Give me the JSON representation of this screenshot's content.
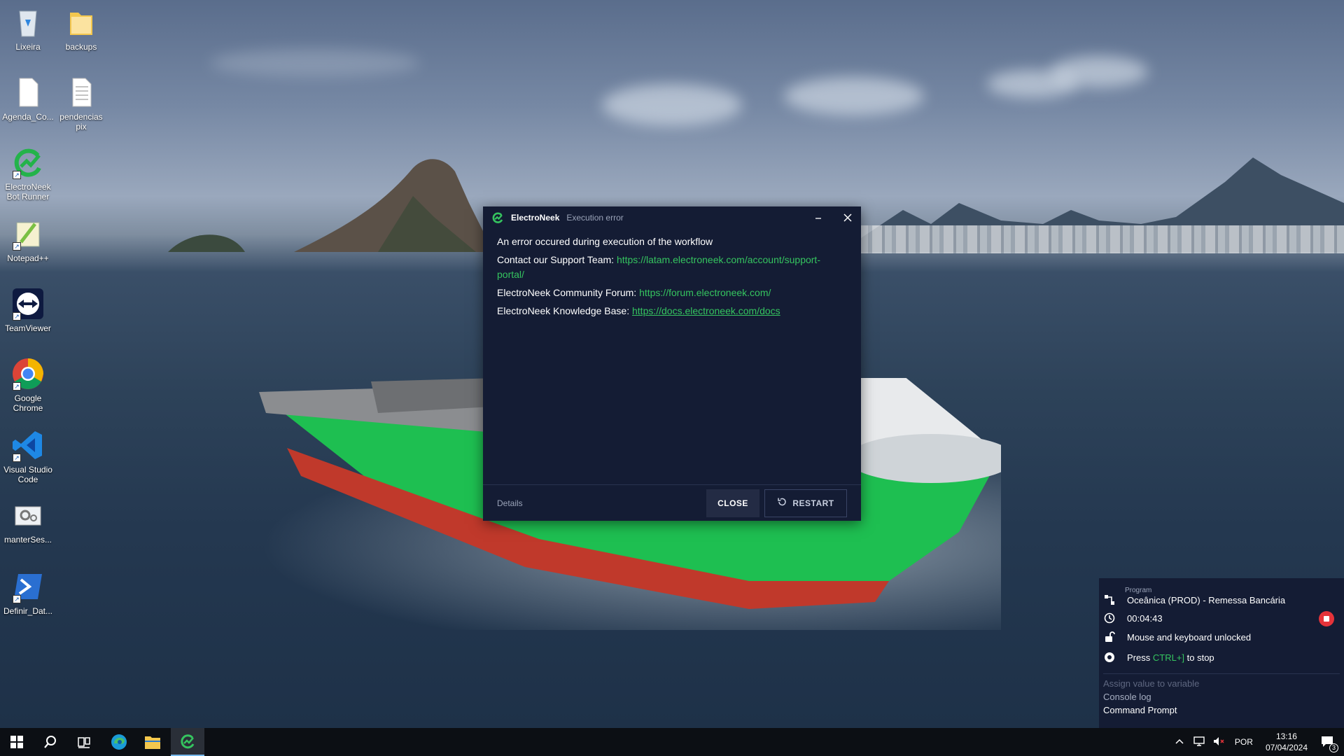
{
  "desktop": {
    "icons": [
      {
        "label": "Lixeira",
        "icon": "recycle-bin-icon"
      },
      {
        "label": "backups",
        "icon": "folder-icon"
      },
      {
        "label": "Agenda_Co...",
        "icon": "document-icon"
      },
      {
        "label": "pendencias pix",
        "icon": "text-document-icon"
      },
      {
        "label": "ElectroNeek Bot Runner",
        "icon": "electroneek-icon"
      },
      {
        "label": "Notepad++",
        "icon": "notepad-plus-plus-icon"
      },
      {
        "label": "TeamViewer",
        "icon": "teamviewer-icon"
      },
      {
        "label": "Google Chrome",
        "icon": "chrome-icon"
      },
      {
        "label": "Visual Studio Code",
        "icon": "vscode-icon"
      },
      {
        "label": "manterSes...",
        "icon": "settings-file-icon"
      },
      {
        "label": "Definir_Dat...",
        "icon": "powershell-icon"
      }
    ]
  },
  "dialog": {
    "app_name": "ElectroNeek",
    "subtitle": "Execution error",
    "message": "An error occured during execution of the workflow",
    "support_label": "Contact our Support Team:",
    "support_link": "https://latam.electroneek.com/account/support-portal/",
    "forum_label": "ElectroNeek Community Forum:",
    "forum_link": "https://forum.electroneek.com/",
    "kb_label": "ElectroNeek Knowledge Base:",
    "kb_link": "https://docs.electroneek.com/docs",
    "details_label": "Details",
    "close_label": "CLOSE",
    "restart_label": "RESTART"
  },
  "runner": {
    "program_label": "Program",
    "program_name": "Oceânica (PROD) - Remessa Bancária",
    "elapsed": "00:04:43",
    "lock_status": "Mouse and keyboard unlocked",
    "stop_hint_prefix": "Press",
    "stop_hint_keys": "CTRL+]",
    "stop_hint_suffix": "to stop",
    "log": [
      "Assign value to variable",
      "Console log",
      "Command Prompt"
    ]
  },
  "taskbar": {
    "language": "POR",
    "time": "13:16",
    "date": "07/04/2024",
    "notification_count": "3"
  },
  "colors": {
    "accent_green": "#35c45f",
    "dialog_bg": "#141c34",
    "stop_red": "#e5333a"
  }
}
